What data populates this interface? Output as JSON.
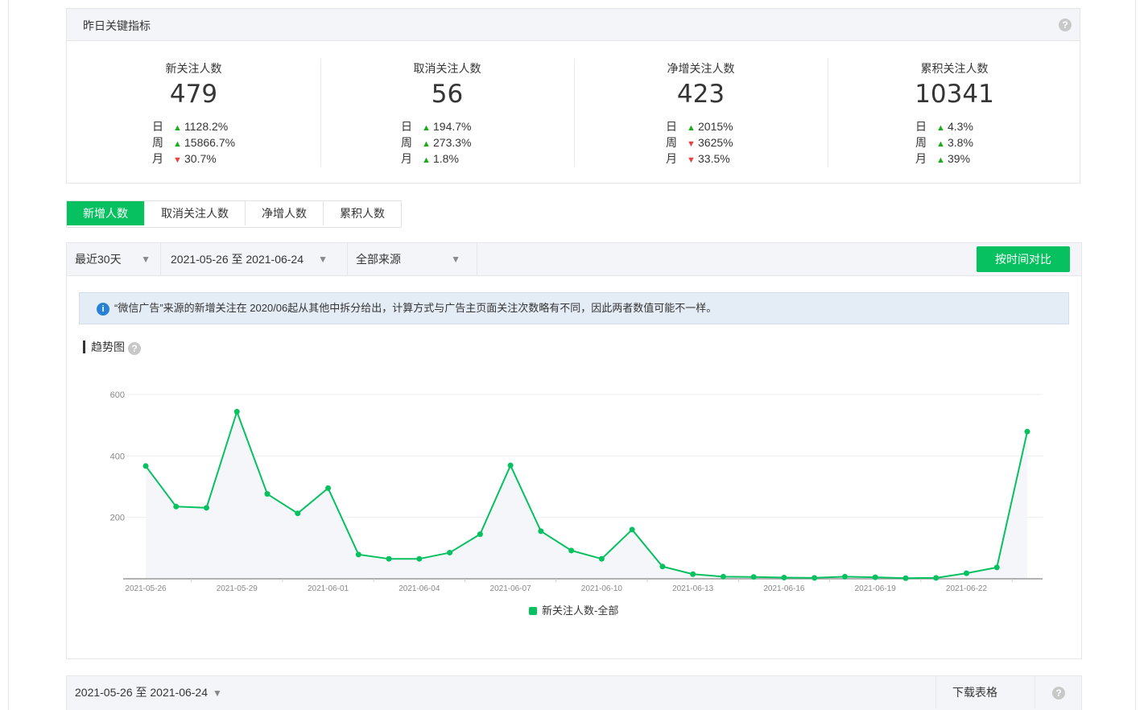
{
  "metrics": {
    "title": "昨日关键指标",
    "items": [
      {
        "name": "新关注人数",
        "value": "479",
        "rows": [
          {
            "label": "日",
            "dir": "up",
            "pct": "1128.2%"
          },
          {
            "label": "周",
            "dir": "up",
            "pct": "15866.7%"
          },
          {
            "label": "月",
            "dir": "down",
            "pct": "30.7%"
          }
        ]
      },
      {
        "name": "取消关注人数",
        "value": "56",
        "rows": [
          {
            "label": "日",
            "dir": "up",
            "pct": "194.7%"
          },
          {
            "label": "周",
            "dir": "up",
            "pct": "273.3%"
          },
          {
            "label": "月",
            "dir": "up",
            "pct": "1.8%"
          }
        ]
      },
      {
        "name": "净增关注人数",
        "value": "423",
        "rows": [
          {
            "label": "日",
            "dir": "up",
            "pct": "2015%"
          },
          {
            "label": "周",
            "dir": "down",
            "pct": "3625%"
          },
          {
            "label": "月",
            "dir": "down",
            "pct": "33.5%"
          }
        ]
      },
      {
        "name": "累积关注人数",
        "value": "10341",
        "rows": [
          {
            "label": "日",
            "dir": "up",
            "pct": "4.3%"
          },
          {
            "label": "周",
            "dir": "up",
            "pct": "3.8%"
          },
          {
            "label": "月",
            "dir": "up",
            "pct": "39%"
          }
        ]
      }
    ]
  },
  "tabs": [
    "新增人数",
    "取消关注人数",
    "净增人数",
    "累积人数"
  ],
  "filters": {
    "period": "最近30天",
    "range": "2021-05-26 至 2021-06-24",
    "source": "全部来源",
    "compare_button": "按时间对比"
  },
  "notice": "“微信广告”来源的新增关注在 2020/06起从其他中拆分给出，计算方式与广告主页面关注次数略有不同，因此两者数值可能不一样。",
  "trend_title": "趋势图",
  "help_glyph": "?",
  "info_glyph": "i",
  "caret_glyph": "▼",
  "colors": {
    "accent": "#07c160",
    "up": "#1aad19",
    "down": "#e64340"
  },
  "chart_data": {
    "type": "line",
    "x": [
      "2021-05-26",
      "2021-05-27",
      "2021-05-28",
      "2021-05-29",
      "2021-05-30",
      "2021-05-31",
      "2021-06-01",
      "2021-06-02",
      "2021-06-03",
      "2021-06-04",
      "2021-06-05",
      "2021-06-06",
      "2021-06-07",
      "2021-06-08",
      "2021-06-09",
      "2021-06-10",
      "2021-06-11",
      "2021-06-12",
      "2021-06-13",
      "2021-06-14",
      "2021-06-15",
      "2021-06-16",
      "2021-06-17",
      "2021-06-18",
      "2021-06-19",
      "2021-06-20",
      "2021-06-21",
      "2021-06-22",
      "2021-06-23",
      "2021-06-24"
    ],
    "xticks": [
      "2021-05-26",
      "2021-05-29",
      "2021-06-01",
      "2021-06-04",
      "2021-06-07",
      "2021-06-10",
      "2021-06-13",
      "2021-06-16",
      "2021-06-19",
      "2021-06-22"
    ],
    "yticks": [
      200,
      400,
      600
    ],
    "ylim": [
      0,
      600
    ],
    "grid": true,
    "legend_position": "bottom",
    "series": [
      {
        "name": "新关注人数-全部",
        "values": [
          367,
          235,
          231,
          544,
          276,
          213,
          295,
          79,
          65,
          65,
          85,
          145,
          369,
          155,
          92,
          65,
          160,
          40,
          15,
          7,
          6,
          4,
          3,
          7,
          5,
          2,
          3,
          18,
          37,
          479
        ]
      }
    ]
  },
  "bottom_bar": {
    "range": "2021-05-26 至 2021-06-24",
    "download": "下载表格"
  }
}
